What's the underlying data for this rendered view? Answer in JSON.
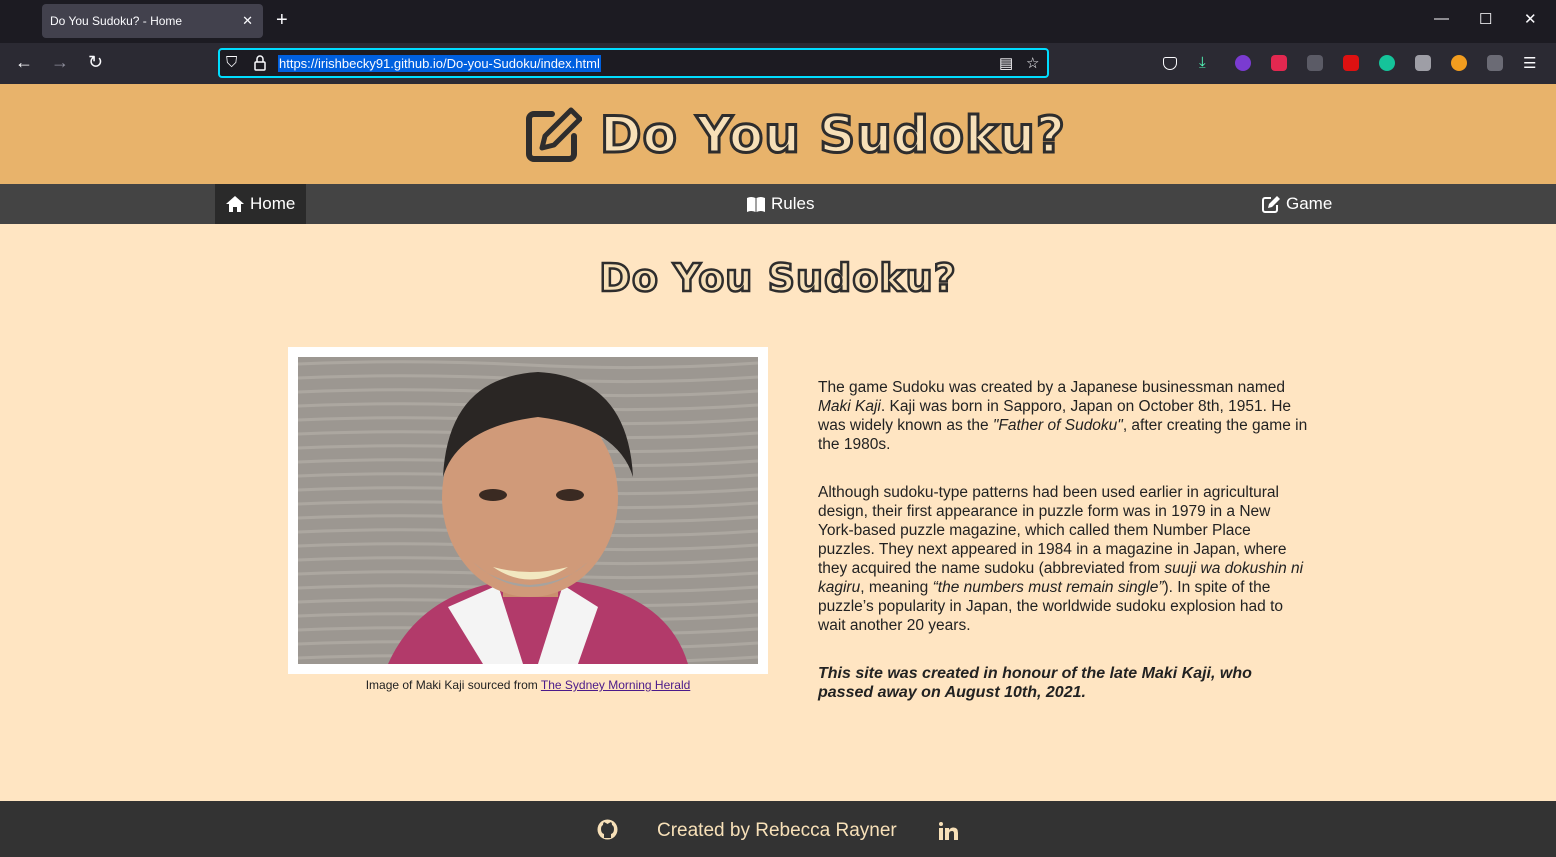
{
  "browser": {
    "tab_title": "Do You Sudoku? - Home",
    "tab_close": "✕",
    "new_tab": "+",
    "url": "https://irishbecky91.github.io/Do-you-Sudoku/index.html",
    "minimize": "—",
    "maximize": "☐",
    "close": "✕"
  },
  "header": {
    "logo_text": "Do You Sudoku?"
  },
  "nav": {
    "items": [
      {
        "label": "Home",
        "active": true
      },
      {
        "label": "Rules",
        "active": false
      },
      {
        "label": "Game",
        "active": false
      }
    ]
  },
  "main": {
    "title": "Do You Sudoku?",
    "caption_prefix": "Image of Maki Kaji sourced from ",
    "caption_link": "The Sydney Morning Herald",
    "p1_a": "The game Sudoku was created by a Japanese businessman named ",
    "p1_em": "Maki Kaji",
    "p1_b": ". Kaji was born in Sapporo, Japan on October 8th, 1951. He was widely known as the ",
    "p1_em2": "\"Father of Sudoku\"",
    "p1_c": ", after creating the game in the 1980s.",
    "p2_a": "Although sudoku-type patterns had been used earlier in agricultural design, their first appearance in puzzle form was in 1979 in a New York-based puzzle magazine, which called them Number Place puzzles. They next appeared in 1984 in a magazine in Japan, where they acquired the name sudoku (abbreviated from ",
    "p2_em": "suuji wa dokushin ni kagiru",
    "p2_b": ", meaning ",
    "p2_em2": "“the numbers must remain single”",
    "p2_c": "). In spite of the puzzle’s popularity in Japan, the worldwide sudoku explosion had to wait another 20 years.",
    "p3": "This site was created in honour of the late Maki Kaji, who passed away on August 10th, 2021."
  },
  "footer": {
    "text": "Created by Rebecca Rayner"
  },
  "colors": {
    "header": "#e8b36b",
    "page": "#ffe5c2",
    "nav": "#444444",
    "footer": "#333333"
  }
}
